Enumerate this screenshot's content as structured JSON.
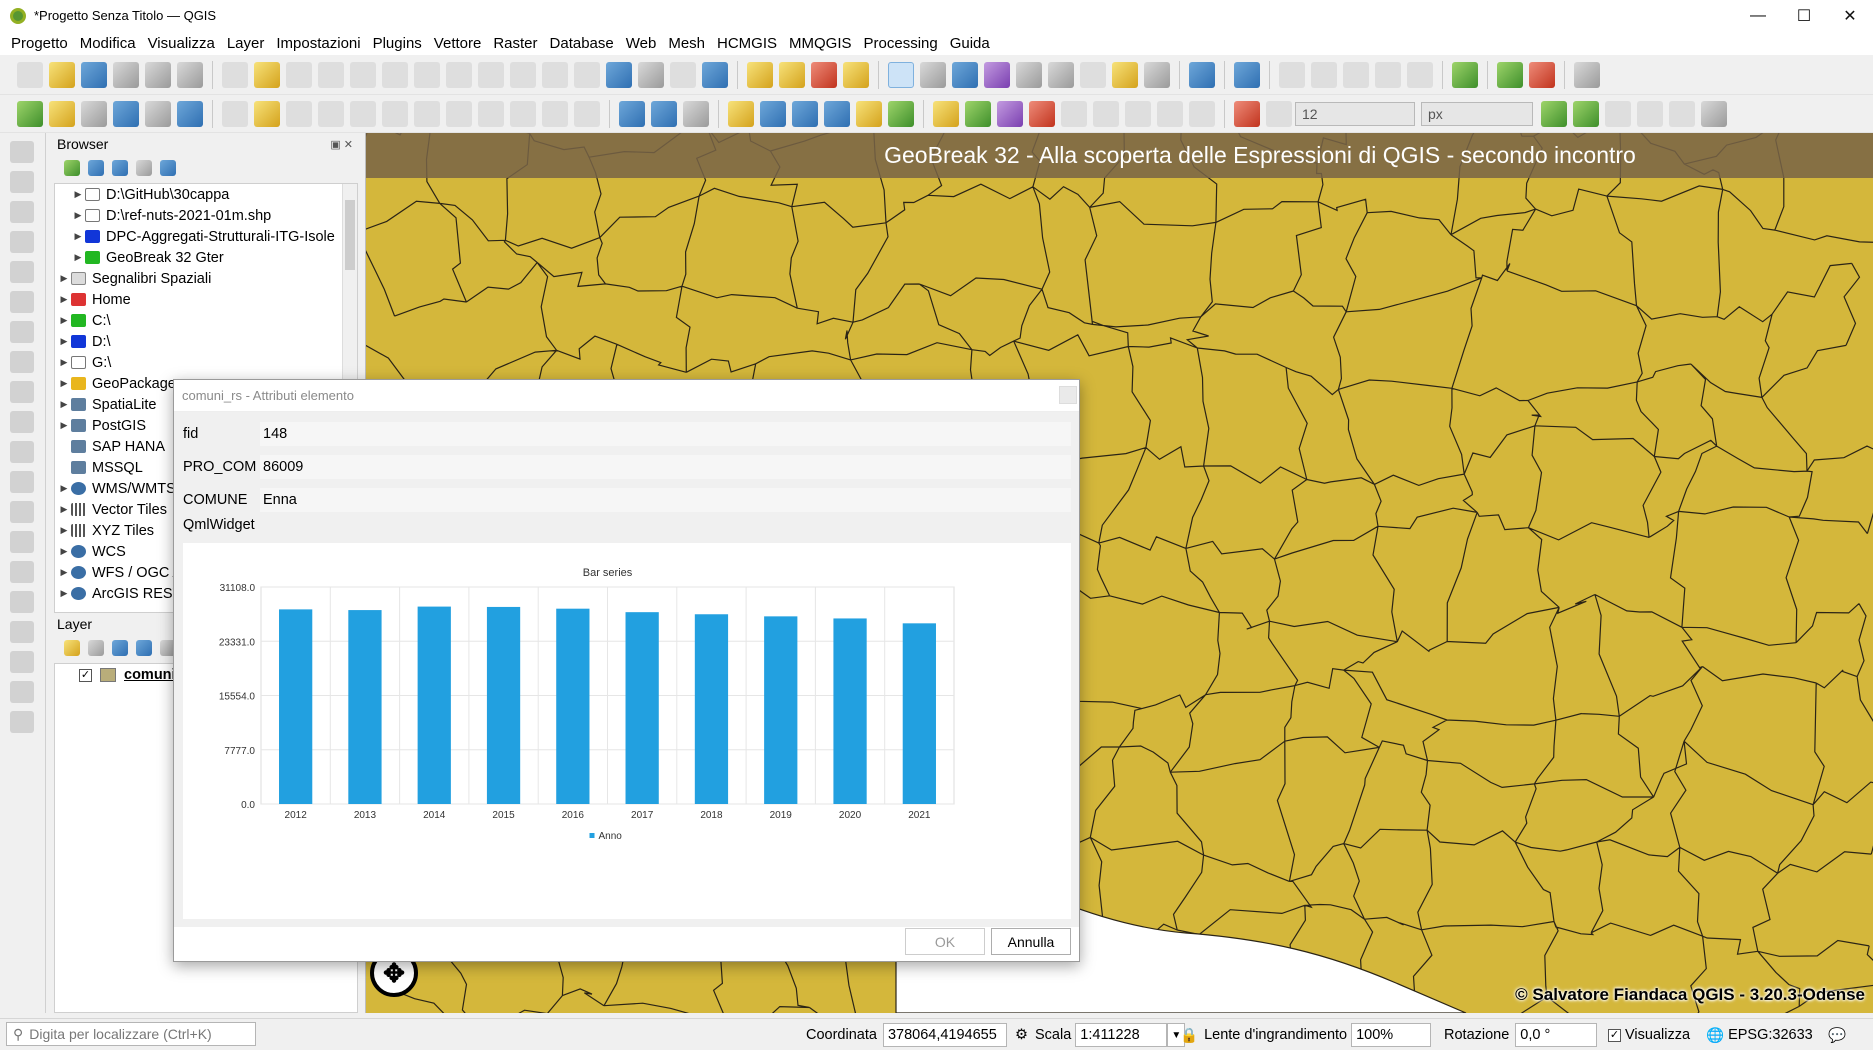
{
  "window": {
    "title": "*Progetto Senza Titolo — QGIS",
    "controls": [
      "—",
      "☐",
      "✕"
    ]
  },
  "menubar": [
    "Progetto",
    "Modifica",
    "Visualizza",
    "Layer",
    "Impostazioni",
    "Plugins",
    "Vettore",
    "Raster",
    "Database",
    "Web",
    "Mesh",
    "HCMGIS",
    "MMQGIS",
    "Processing",
    "Guida"
  ],
  "toolbar2": {
    "font_size_value": "12",
    "unit_value": "px"
  },
  "browser": {
    "title": "Browser",
    "items": [
      {
        "label": "D:\\GitHub\\30cappa",
        "icon": "folder-icon",
        "indent": 1
      },
      {
        "label": "D:\\ref-nuts-2021-01m.shp",
        "icon": "folder-icon",
        "indent": 1
      },
      {
        "label": "DPC-Aggregati-Strutturali-ITG-Isole",
        "icon": "blue-folder-icon",
        "indent": 1
      },
      {
        "label": "GeoBreak 32 Gter",
        "icon": "green-folder-icon",
        "indent": 1
      },
      {
        "label": "Segnalibri Spaziali",
        "icon": "bookmark-icon",
        "indent": 0
      },
      {
        "label": "Home",
        "icon": "home-icon",
        "indent": 0
      },
      {
        "label": "C:\\",
        "icon": "green-folder-icon",
        "indent": 0
      },
      {
        "label": "D:\\",
        "icon": "blue-folder-icon",
        "indent": 0
      },
      {
        "label": "G:\\",
        "icon": "folder-icon",
        "indent": 0
      },
      {
        "label": "GeoPackage",
        "icon": "geopackage-icon",
        "indent": 0
      },
      {
        "label": "SpatiaLite",
        "icon": "spatialite-icon",
        "indent": 0
      },
      {
        "label": "PostGIS",
        "icon": "postgis-icon",
        "indent": 0
      },
      {
        "label": "SAP HANA",
        "icon": "sap-hana-icon",
        "indent": 0
      },
      {
        "label": "MSSQL",
        "icon": "mssql-icon",
        "indent": 0
      },
      {
        "label": "WMS/WMTS",
        "icon": "globe-icon",
        "indent": 0
      },
      {
        "label": "Vector Tiles",
        "icon": "grid-icon",
        "indent": 0
      },
      {
        "label": "XYZ Tiles",
        "icon": "grid-icon",
        "indent": 0
      },
      {
        "label": "WCS",
        "icon": "globe-icon",
        "indent": 0
      },
      {
        "label": "WFS / OGC API",
        "icon": "globe-icon",
        "indent": 0
      },
      {
        "label": "ArcGIS REST",
        "icon": "globe-icon",
        "indent": 0
      }
    ]
  },
  "layers": {
    "title": "Layer",
    "items": [
      {
        "label": "comuni_rs",
        "checked": "✓"
      }
    ]
  },
  "map": {
    "title": "GeoBreak 32 - Alla scoperta delle Espressioni di QGIS - secondo incontro",
    "credit": "© Salvatore Fiandaca QGIS - 3.20.3-Odense",
    "fill_color": "#d4b73b",
    "line_color": "#2b2416"
  },
  "dialog": {
    "title": "comuni_rs - Attributi elemento",
    "fields": [
      {
        "label": "fid",
        "value": "148"
      },
      {
        "label": "PRO_COM",
        "value": "86009"
      },
      {
        "label": "COMUNE",
        "value": "Enna"
      }
    ],
    "widget_label": "QmlWidget",
    "ok_label": "OK",
    "cancel_label": "Annulla"
  },
  "chart_data": {
    "type": "bar",
    "title": "Bar series",
    "categories": [
      "2012",
      "2013",
      "2014",
      "2015",
      "2016",
      "2017",
      "2018",
      "2019",
      "2020",
      "2021"
    ],
    "series": [
      {
        "name": "Anno",
        "color": "#22a0e0",
        "values": [
          27900,
          27800,
          28300,
          28250,
          28000,
          27500,
          27200,
          26900,
          26600,
          25900
        ]
      }
    ],
    "ylim": [
      0,
      31108.0
    ],
    "yticks": [
      "31108.0",
      "23331.0",
      "15554.0",
      "7777.0",
      "0.0"
    ],
    "grid": true,
    "legend": "bottom"
  },
  "statusbar": {
    "locator_placeholder": "Digita per localizzare (Ctrl+K)",
    "coord_label": "Coordinata",
    "coord_value": "378064,4194655",
    "scale_label": "Scala",
    "scale_value": "1:411228",
    "magnifier_label": "Lente d'ingrandimento",
    "magnifier_value": "100%",
    "rotation_label": "Rotazione",
    "rotation_value": "0,0 °",
    "render_label": "Visualizza",
    "crs_value": "EPSG:32633"
  }
}
